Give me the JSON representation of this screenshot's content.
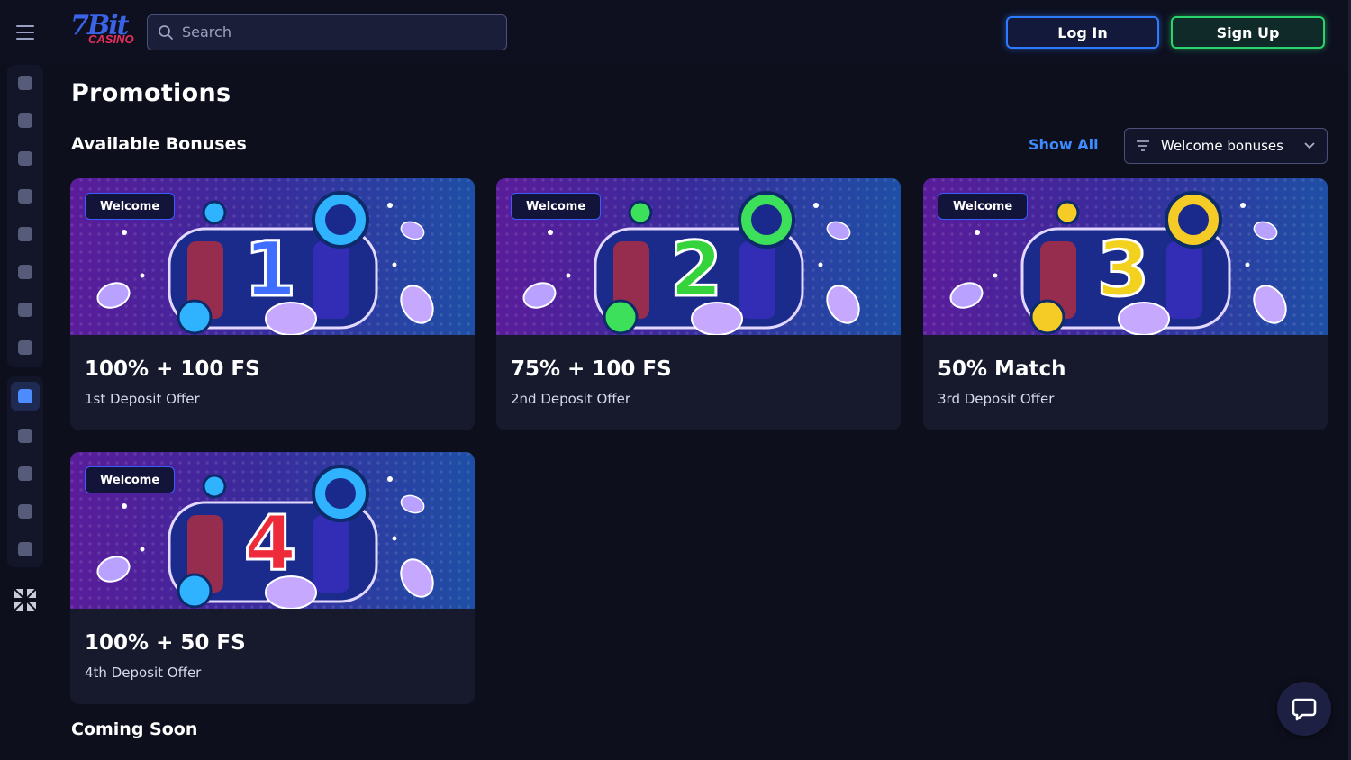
{
  "header": {
    "logo": {
      "main": "7Bit",
      "sub": "CASINO"
    },
    "search_placeholder": "Search",
    "login_label": "Log In",
    "signup_label": "Sign Up"
  },
  "sidebar": {
    "items": [
      {
        "icon": "fire-icon"
      },
      {
        "icon": "stars-icon"
      },
      {
        "icon": "lightning-icon"
      },
      {
        "icon": "target-icon"
      },
      {
        "icon": "clubs-icon"
      },
      {
        "icon": "dealer-icon"
      },
      {
        "icon": "rocket-icon"
      },
      {
        "icon": "cards-icon"
      },
      {
        "icon": "gift-icon",
        "active": true
      },
      {
        "icon": "trophy-icon"
      },
      {
        "icon": "crown-icon"
      },
      {
        "icon": "credit-card-icon"
      },
      {
        "icon": "treasure-icon"
      }
    ],
    "language_icon": "uk-flag-icon"
  },
  "main": {
    "page_title": "Promotions",
    "section_title": "Available Bonuses",
    "show_all": "Show All",
    "filter_label": "Welcome bonuses",
    "cards": [
      {
        "badge": "Welcome",
        "number": "1",
        "number_color": "#3f6dff",
        "chip_color": "#2fb3ff",
        "title": "100% + 100 FS",
        "subtitle": "1st Deposit Offer"
      },
      {
        "badge": "Welcome",
        "number": "2",
        "number_color": "#35d43c",
        "chip_color": "#3de05a",
        "title": "75% + 100 FS",
        "subtitle": "2nd Deposit Offer"
      },
      {
        "badge": "Welcome",
        "number": "3",
        "number_color": "#f2d21e",
        "chip_color": "#f5cc25",
        "title": "50% Match",
        "subtitle": "3rd Deposit Offer"
      },
      {
        "badge": "Welcome",
        "number": "4",
        "number_color": "#ee2b3a",
        "chip_color": "#2fb3ff",
        "title": "100% + 50 FS",
        "subtitle": "4th Deposit Offer"
      }
    ],
    "coming_soon": "Coming Soon"
  },
  "chat": {
    "icon": "chat-bubble-icon"
  }
}
